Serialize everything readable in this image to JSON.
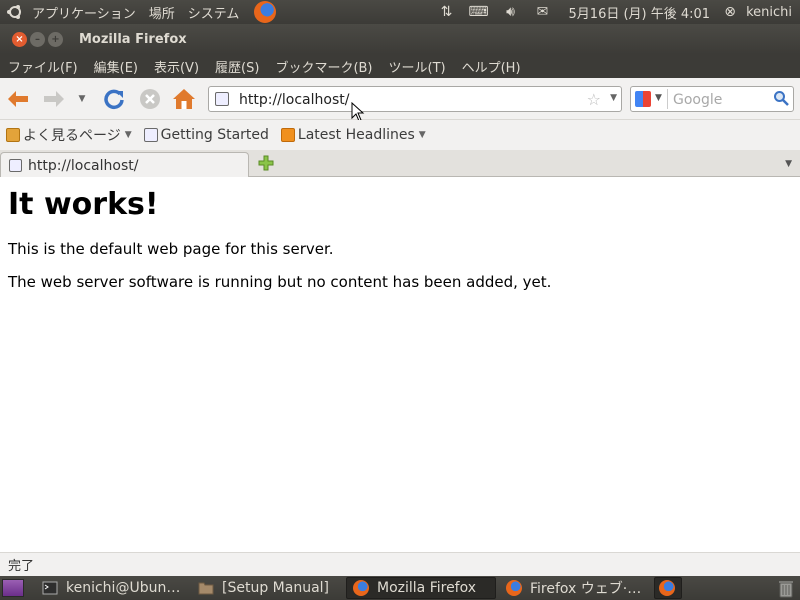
{
  "top_panel": {
    "menus": [
      "アプリケーション",
      "場所",
      "システム"
    ],
    "clock": "5月16日 (月) 午後 4:01",
    "user": "kenichi"
  },
  "window": {
    "title": "Mozilla Firefox"
  },
  "menubar": [
    "ファイル(F)",
    "編集(E)",
    "表示(V)",
    "履歴(S)",
    "ブックマーク(B)",
    "ツール(T)",
    "ヘルプ(H)"
  ],
  "navbar": {
    "url": "http://localhost/",
    "search_placeholder": "Google"
  },
  "bookmarks": {
    "items": [
      "よく見るページ",
      "Getting Started",
      "Latest Headlines"
    ]
  },
  "tabs": [
    {
      "label": "http://localhost/"
    }
  ],
  "page": {
    "heading": "It works!",
    "paragraphs": [
      "This is the default web page for this server.",
      "The web server software is running but no content has been added, yet."
    ]
  },
  "status": "完了",
  "taskbar": {
    "tasks": [
      "kenichi@Ubun…",
      "[Setup Manual]",
      "Mozilla Firefox",
      "Firefox ウェブ·…"
    ]
  },
  "colors": {
    "panel": "#3c3b37",
    "toolbar": "#f2f1f0",
    "close_button": "#e25c30",
    "back_arrow": "#e07a2d",
    "reload": "#3b73c4"
  }
}
